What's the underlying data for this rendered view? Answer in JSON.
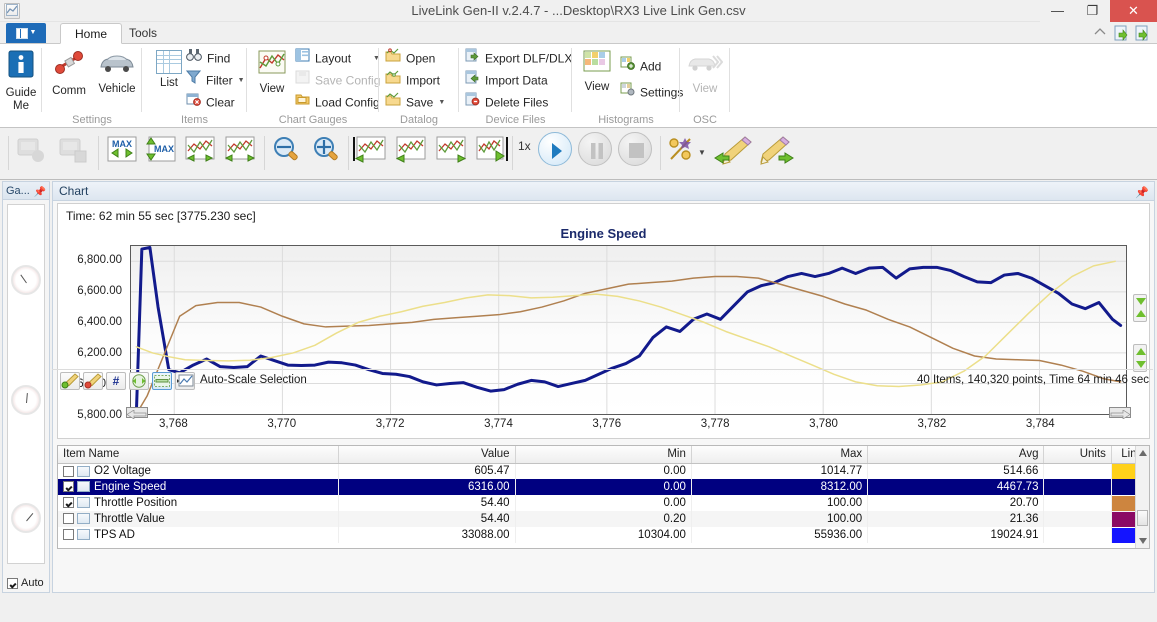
{
  "window": {
    "title": "LiveLink Gen-II  v.2.4.7 - ...Desktop\\RX3 Live Link Gen.csv",
    "app_icon": "chart-app-icon",
    "minimize": "—",
    "maximize": "❐",
    "close": "✕"
  },
  "tabs": {
    "app_menu": "File",
    "items": [
      {
        "label": "Home",
        "active": true
      },
      {
        "label": "Tools",
        "active": false
      }
    ],
    "quick_access": [
      "help-icon",
      "import-icon",
      "export-icon"
    ]
  },
  "ribbon": {
    "groups": [
      {
        "name": "",
        "label": "",
        "big": [
          {
            "label": "Guide\nMe",
            "line1": "Guide",
            "line2": "Me",
            "icon": "info-icon"
          }
        ]
      },
      {
        "name": "settings",
        "label": "Settings",
        "big": [
          {
            "line1": "Comm",
            "line2": "",
            "icon": "connector-icon"
          },
          {
            "line1": "Vehicle",
            "line2": "",
            "icon": "car-icon"
          }
        ]
      },
      {
        "name": "items",
        "label": "Items",
        "big": [
          {
            "line1": "List",
            "line2": "",
            "icon": "list-grid-icon"
          }
        ],
        "small": [
          {
            "label": "Find",
            "icon": "binoculars-icon",
            "disabled": false,
            "dropdown": false
          },
          {
            "label": "Filter",
            "icon": "funnel-icon",
            "disabled": false,
            "dropdown": true
          },
          {
            "label": "Clear",
            "icon": "clear-icon",
            "disabled": false,
            "dropdown": false
          }
        ]
      },
      {
        "name": "chart-gauges",
        "label": "Chart  Gauges",
        "big": [
          {
            "line1": "View",
            "line2": "",
            "icon": "chart-view-icon"
          }
        ],
        "small": [
          {
            "label": "Layout",
            "icon": "layout-icon",
            "disabled": false,
            "dropdown": true
          },
          {
            "label": "Save Config",
            "icon": "save-config-icon",
            "disabled": true,
            "dropdown": false
          },
          {
            "label": "Load Config",
            "icon": "load-config-icon",
            "disabled": false,
            "dropdown": false
          }
        ]
      },
      {
        "name": "datalog",
        "label": "Datalog",
        "small": [
          {
            "label": "Open",
            "icon": "open-folder-icon",
            "disabled": false,
            "dropdown": false
          },
          {
            "label": "Import",
            "icon": "import-icon",
            "disabled": false,
            "dropdown": false
          },
          {
            "label": "Save",
            "icon": "save-icon",
            "disabled": false,
            "dropdown": true
          }
        ]
      },
      {
        "name": "device-files",
        "label": "Device Files",
        "small": [
          {
            "label": "Export DLF/DLX",
            "icon": "export-file-icon",
            "disabled": false,
            "dropdown": false
          },
          {
            "label": "Import Data",
            "icon": "import-data-icon",
            "disabled": false,
            "dropdown": false
          },
          {
            "label": "Delete Files",
            "icon": "delete-file-icon",
            "disabled": false,
            "dropdown": false
          }
        ]
      },
      {
        "name": "histograms",
        "label": "Histograms",
        "big": [
          {
            "line1": "View",
            "line2": "",
            "icon": "histogram-icon"
          }
        ],
        "small": [
          {
            "label": "Add",
            "icon": "add-histogram-icon",
            "disabled": false,
            "dropdown": false
          },
          {
            "label": "Settings",
            "icon": "histogram-settings-icon",
            "disabled": false,
            "dropdown": false
          }
        ]
      },
      {
        "name": "osc",
        "label": "OSC",
        "big": [
          {
            "line1": "View",
            "line2": "",
            "icon": "osc-icon",
            "disabled": true
          }
        ]
      }
    ]
  },
  "toolbar": {
    "speed_label": "1x",
    "buttons": [
      "device-read-icon",
      "device-write-icon",
      "max-left-right-icon",
      "max-up-down-icon",
      "scroll-chart-left-right-icon",
      "expand-chart-icon",
      "zoom-out-icon",
      "zoom-in-icon",
      "chart-start-icon",
      "chart-prev-icon",
      "chart-next-icon",
      "chart-end-icon",
      "play-icon",
      "pause-icon",
      "stop-icon",
      "percent-icon",
      "mark-back-icon",
      "mark-forward-icon"
    ]
  },
  "left_panel": {
    "title": "Ga...",
    "pin": "pin-icon",
    "gauges": [
      "gauge-1",
      "gauge-2",
      "gauge-3"
    ],
    "auto_label": "Auto",
    "auto_checked": true
  },
  "chart_panel": {
    "title": "Chart",
    "pin": "pin-icon"
  },
  "chart_data": {
    "type": "line",
    "title": "Engine Speed",
    "time_label": "Time: 62 min 55 sec [3775.230 sec]",
    "xlabel": "",
    "ylabel": "",
    "grid": true,
    "legend": "none",
    "xlim": [
      3767.2,
      3785.6
    ],
    "ylim": [
      5800,
      6900
    ],
    "xticks": [
      "3,768",
      "3,770",
      "3,772",
      "3,774",
      "3,776",
      "3,778",
      "3,780",
      "3,782",
      "3,784"
    ],
    "xtick_values": [
      3768,
      3770,
      3772,
      3774,
      3776,
      3778,
      3780,
      3782,
      3784
    ],
    "yticks": [
      "6,800.00",
      "6,600.00",
      "6,400.00",
      "6,200.00",
      "6,000.00",
      "5,800.00"
    ],
    "ytick_values": [
      6800,
      6600,
      6400,
      6200,
      6000,
      5800
    ],
    "series": [
      {
        "name": "Engine Speed",
        "color": "#121a8c",
        "width": 3,
        "x": [
          3767.3,
          3767.4,
          3767.55,
          3767.7,
          3767.9,
          3768.1,
          3768.35,
          3768.6,
          3768.85,
          3769.1,
          3769.35,
          3769.6,
          3769.85,
          3770.1,
          3770.35,
          3770.6,
          3770.85,
          3771.1,
          3771.35,
          3771.6,
          3771.85,
          3772.1,
          3772.35,
          3772.6,
          3772.85,
          3773.1,
          3773.35,
          3773.6,
          3773.85,
          3774.1,
          3774.35,
          3774.6,
          3774.85,
          3775.1,
          3775.35,
          3775.6,
          3775.85,
          3776.1,
          3776.35,
          3776.6,
          3776.85,
          3777.1,
          3777.35,
          3777.6,
          3777.85,
          3778.1,
          3778.35,
          3778.6,
          3778.85,
          3779.1,
          3779.35,
          3779.6,
          3779.85,
          3780.1,
          3780.35,
          3780.6,
          3780.85,
          3781.1,
          3781.35,
          3781.6,
          3781.85,
          3782.1,
          3782.35,
          3782.6,
          3782.85,
          3783.1,
          3783.35,
          3783.6,
          3783.85,
          3784.1,
          3784.35,
          3784.6,
          3784.85,
          3785.1,
          3785.35,
          3785.5
        ],
        "y": [
          5810,
          6880,
          6890,
          6500,
          6090,
          6070,
          6120,
          6160,
          6110,
          6105,
          6110,
          6180,
          6150,
          6120,
          6118,
          6120,
          6140,
          6135,
          6120,
          6090,
          6065,
          6060,
          6045,
          6010,
          5990,
          6000,
          6005,
          5975,
          5950,
          5960,
          5995,
          6020,
          6010,
          5980,
          6000,
          6020,
          6060,
          6100,
          6130,
          6180,
          6300,
          6370,
          6340,
          6420,
          6455,
          6420,
          6510,
          6600,
          6640,
          6660,
          6700,
          6720,
          6700,
          6720,
          6755,
          6720,
          6755,
          6760,
          6690,
          6750,
          6760,
          6760,
          6740,
          6700,
          6665,
          6660,
          6710,
          6720,
          6690,
          6640,
          6590,
          6520,
          6490,
          6530,
          6420,
          6380,
          6300,
          6250,
          6190,
          6120,
          6150,
          6090,
          6020,
          5950,
          5930,
          5950,
          5820
        ],
        "note": "thick dark navy line, spikes to ~6,890 at start, dips near 5,950 around 3,773, rises to peak ~6,760 near 3,780, falls to ~5,820 at right edge"
      },
      {
        "name": "Throttle Position",
        "color": "#b08050",
        "width": 1.5,
        "x": [
          3767.3,
          3767.5,
          3767.8,
          3768.1,
          3768.4,
          3768.8,
          3769.2,
          3769.6,
          3770.0,
          3770.4,
          3770.8,
          3771.2,
          3771.6,
          3772.0,
          3772.4,
          3772.8,
          3773.2,
          3773.6,
          3774.0,
          3774.4,
          3774.8,
          3775.2,
          3775.6,
          3776.0,
          3776.4,
          3776.8,
          3777.2,
          3777.6,
          3778.0,
          3778.4,
          3778.8,
          3779.2,
          3779.6,
          3780.0,
          3780.4,
          3780.8,
          3781.2,
          3781.6,
          3782.0,
          3782.4,
          3782.8,
          3783.2,
          3783.6,
          3784.0,
          3784.4,
          3784.8,
          3785.2,
          3785.5
        ],
        "y": [
          5800,
          5920,
          6180,
          6440,
          6510,
          6530,
          6530,
          6500,
          6440,
          6390,
          6370,
          6375,
          6380,
          6390,
          6400,
          6420,
          6430,
          6440,
          6450,
          6470,
          6500,
          6540,
          6590,
          6620,
          6650,
          6660,
          6670,
          6690,
          6700,
          6700,
          6690,
          6650,
          6610,
          6570,
          6520,
          6480,
          6420,
          6370,
          6300,
          6230,
          6180,
          6160,
          6155,
          6150,
          6120,
          6080,
          6030,
          6010
        ],
        "note": "thin tan/brown line rising early to ~6,530, dipping, then rising to ~6,700 plateau around 3,778-3,779 then descending"
      },
      {
        "name": "O2 Voltage",
        "color": "#ecdf8a",
        "width": 1.5,
        "x": [
          3767.3,
          3767.6,
          3767.9,
          3768.2,
          3768.6,
          3769.0,
          3769.4,
          3769.8,
          3770.2,
          3770.6,
          3771.0,
          3771.4,
          3771.8,
          3772.2,
          3772.6,
          3773.0,
          3773.4,
          3773.8,
          3774.2,
          3774.6,
          3775.0,
          3775.4,
          3775.8,
          3776.2,
          3776.6,
          3777.0,
          3777.4,
          3777.8,
          3778.2,
          3778.6,
          3779.0,
          3779.4,
          3779.8,
          3780.2,
          3780.6,
          3781.0,
          3781.4,
          3781.8,
          3782.2,
          3782.6,
          3783.0,
          3783.4,
          3783.8,
          3784.2,
          3784.6,
          3785.0,
          3785.4
        ],
        "y": [
          6240,
          6200,
          6175,
          6155,
          6150,
          6148,
          6152,
          6170,
          6200,
          6250,
          6330,
          6400,
          6440,
          6470,
          6505,
          6530,
          6560,
          6580,
          6575,
          6560,
          6565,
          6575,
          6585,
          6570,
          6540,
          6500,
          6450,
          6400,
          6340,
          6290,
          6240,
          6180,
          6120,
          6060,
          6010,
          5985,
          5980,
          5990,
          6010,
          6080,
          6180,
          6320,
          6460,
          6590,
          6700,
          6770,
          6800
        ],
        "note": "pale yellow line starting ~6,240, dipping to ~6,150, rising to ~6,585 plateau mid-chart, descending to ~5,980 near 3,781, then steeply rising to ~6,800 at right edge"
      }
    ]
  },
  "table": {
    "columns": [
      {
        "key": "name",
        "label": "Item Name",
        "align": "left"
      },
      {
        "key": "value",
        "label": "Value",
        "align": "right"
      },
      {
        "key": "min",
        "label": "Min",
        "align": "right"
      },
      {
        "key": "max",
        "label": "Max",
        "align": "right"
      },
      {
        "key": "avg",
        "label": "Avg",
        "align": "right"
      },
      {
        "key": "units",
        "label": "Units",
        "align": "right"
      },
      {
        "key": "line",
        "label": "Line",
        "align": "right"
      }
    ],
    "rows": [
      {
        "checked": false,
        "name": "O2 Voltage",
        "value": "605.47",
        "min": "0.00",
        "max": "1014.77",
        "avg": "514.66",
        "units": "",
        "color": "#ffd11a",
        "selected": false
      },
      {
        "checked": true,
        "name": "Engine Speed",
        "value": "6316.00",
        "min": "0.00",
        "max": "8312.00",
        "avg": "4467.73",
        "units": "",
        "color": "#000080",
        "selected": true
      },
      {
        "checked": true,
        "name": "Throttle Position",
        "value": "54.40",
        "min": "0.00",
        "max": "100.00",
        "avg": "20.70",
        "units": "",
        "color": "#cd853f",
        "selected": false
      },
      {
        "checked": false,
        "name": "Throttle Value",
        "value": "54.40",
        "min": "0.20",
        "max": "100.00",
        "avg": "21.36",
        "units": "",
        "color": "#8b0a64",
        "selected": false
      },
      {
        "checked": false,
        "name": "TPS AD",
        "value": "33088.00",
        "min": "10304.00",
        "max": "55936.00",
        "avg": "19024.91",
        "units": "",
        "color": "#1414ff",
        "selected": false
      }
    ]
  },
  "statusbar": {
    "selection_label": "Auto-Scale Selection",
    "summary": "40 Items, 140,320 points, Time 64 min 46 sec",
    "buttons": [
      "marker-a-icon",
      "marker-b-icon",
      "hash-icon",
      "fit-width-icon",
      "auto-scale-icon",
      "export-image-icon"
    ]
  }
}
